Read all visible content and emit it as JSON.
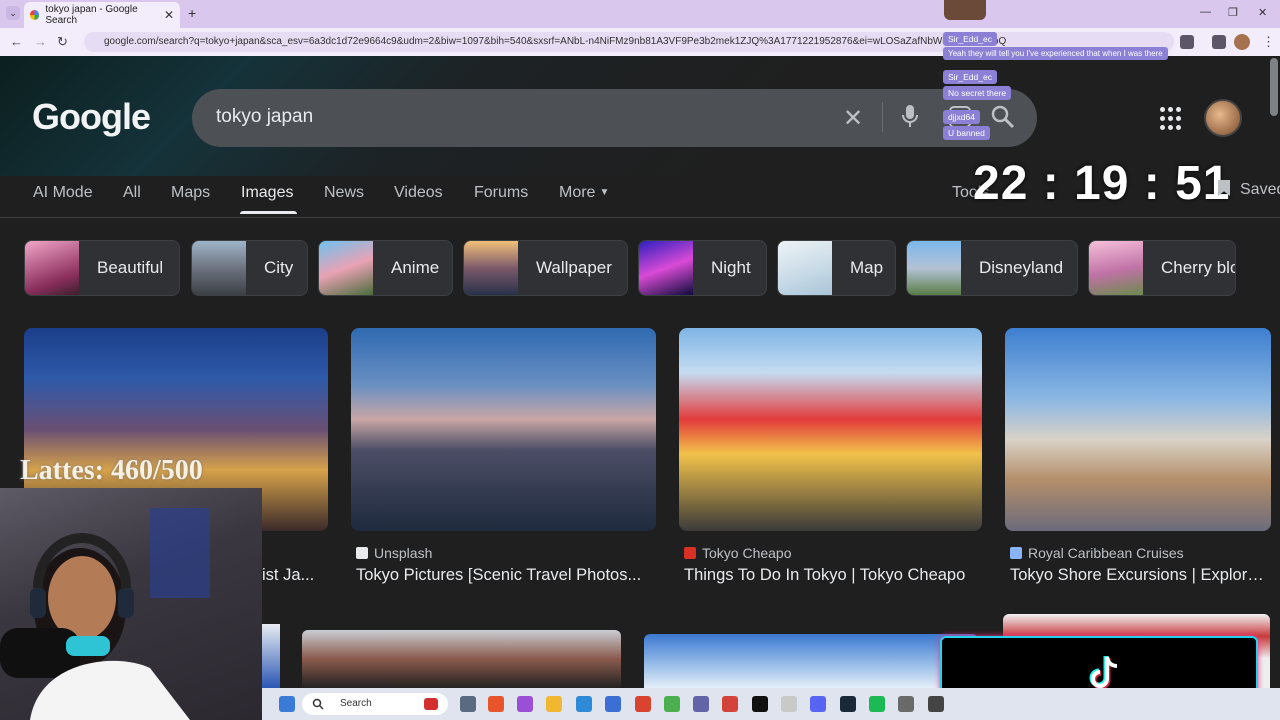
{
  "browser": {
    "tab_title": "tokyo japan - Google Search",
    "url": "google.com/search?q=tokyo+japan&sca_esv=6a3dc1d72e9664c9&udm=2&biw=1097&bih=540&sxsrf=ANbL-n4NiFMz9nb81A3VF9Pe3b2mek1ZJQ%3A1771221952876&ei=wLOSaZafNbWqptQPg821oQ"
  },
  "header": {
    "logo": "Google",
    "query": "tokyo japan"
  },
  "tabs": [
    {
      "label": "AI Mode"
    },
    {
      "label": "All"
    },
    {
      "label": "Maps"
    },
    {
      "label": "Images"
    },
    {
      "label": "News"
    },
    {
      "label": "Videos"
    },
    {
      "label": "Forums"
    },
    {
      "label": "More"
    }
  ],
  "tools_label": "Tools",
  "saved_label": "Saved",
  "clock": "22 : 19 : 51",
  "chips": [
    {
      "label": "Beautiful"
    },
    {
      "label": "City"
    },
    {
      "label": "Anime"
    },
    {
      "label": "Wallpaper"
    },
    {
      "label": "Night"
    },
    {
      "label": "Map"
    },
    {
      "label": "Disneyland"
    },
    {
      "label": "Cherry blo"
    }
  ],
  "results": [
    {
      "source": "",
      "title": "ist Ja..."
    },
    {
      "source": "Unsplash",
      "title": "Tokyo Pictures [Scenic Travel Photos..."
    },
    {
      "source": "Tokyo Cheapo",
      "title": "Things To Do In Tokyo | Tokyo Cheapo"
    },
    {
      "source": "Royal Caribbean Cruises",
      "title": "Tokyo Shore Excursions | Explore ..."
    }
  ],
  "overlay": {
    "goal_text": "Lattes: 460/500",
    "chat": [
      {
        "text": "Sir_Edd_ec"
      },
      {
        "text": "Yeah they will tell you I've experienced that when I was there"
      },
      {
        "text": "Sir_Edd_ec"
      },
      {
        "text": "No secret there"
      },
      {
        "text": "djjxd64"
      },
      {
        "text": "U banned"
      }
    ]
  },
  "taskbar": {
    "search_label": "Search"
  },
  "colors": {
    "background": "#1f1f1f",
    "search_box": "#4d5156",
    "chip_bg": "#303134",
    "text": "#e8eaed",
    "chat_badge": "#8c7fd6",
    "tabbar": "#d9c7ee"
  }
}
